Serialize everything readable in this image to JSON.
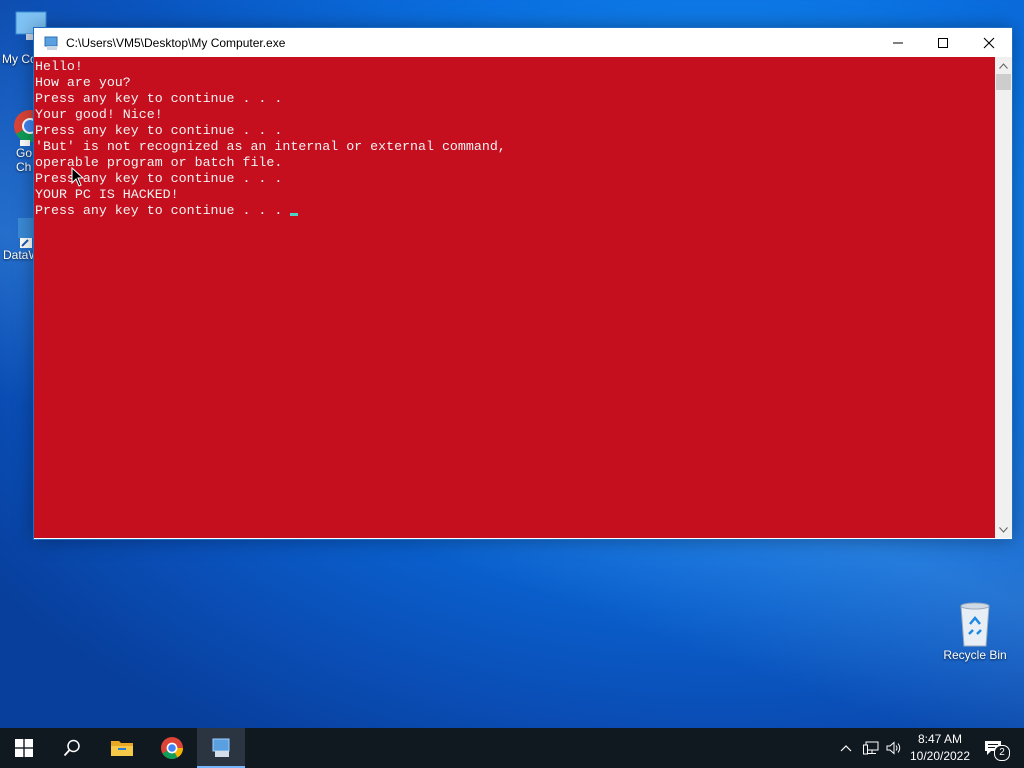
{
  "desktop": {
    "icons": [
      {
        "label": "My Co"
      },
      {
        "label": "Go\nCh"
      },
      {
        "label": "DataW"
      },
      {
        "label": "Recycle Bin"
      }
    ]
  },
  "window": {
    "title": "C:\\Users\\VM5\\Desktop\\My Computer.exe",
    "console_lines": [
      "Hello!",
      "How are you?",
      "Press any key to continue . . .",
      "Your good! Nice!",
      "Press any key to continue . . .",
      "'But' is not recognized as an internal or external command,",
      "operable program or batch file.",
      "Press any key to continue . . .",
      "YOUR PC IS HACKED!",
      "Press any key to continue . . ."
    ],
    "console_bg": "#c50f1f",
    "console_fg": "#f2f2f2"
  },
  "taskbar": {
    "icons": [
      "windows-start-icon",
      "search-icon",
      "file-explorer-icon",
      "chrome-icon",
      "console-app-icon"
    ],
    "clock_time": "8:47 AM",
    "clock_date": "10/20/2022",
    "notification_count": "2"
  }
}
